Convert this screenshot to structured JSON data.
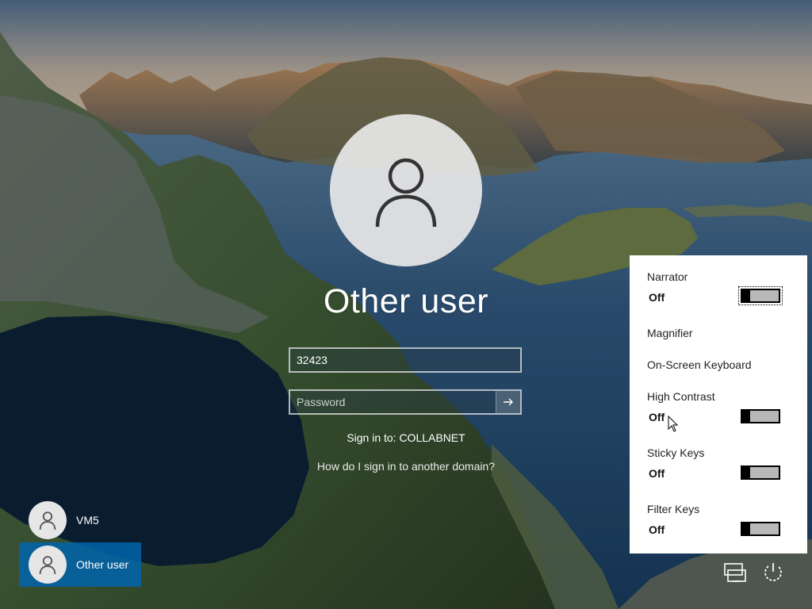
{
  "login": {
    "user_title": "Other user",
    "username_value": "32423",
    "password_placeholder": "Password",
    "sign_in_to": "Sign in to: COLLABNET",
    "domain_link": "How do I sign in to another domain?"
  },
  "users": [
    {
      "name": "VM5",
      "selected": false
    },
    {
      "name": "Other user",
      "selected": true
    }
  ],
  "ease_of_access": {
    "items": [
      {
        "label": "Narrator",
        "state": "Off",
        "has_toggle": true
      },
      {
        "label": "Magnifier",
        "has_toggle": false
      },
      {
        "label": "On-Screen Keyboard",
        "has_toggle": false
      },
      {
        "label": "High Contrast",
        "state": "Off",
        "has_toggle": true
      },
      {
        "label": "Sticky Keys",
        "state": "Off",
        "has_toggle": true
      },
      {
        "label": "Filter Keys",
        "state": "Off",
        "has_toggle": true
      }
    ]
  },
  "icons": {
    "submit": "arrow-right-icon",
    "network": "network-icon",
    "power": "power-icon",
    "avatar": "user-silhouette-icon"
  },
  "colors": {
    "selected_user_bg": "#0064aa",
    "panel_bg": "#ffffff",
    "toggle_track": "#b8b8b8"
  }
}
